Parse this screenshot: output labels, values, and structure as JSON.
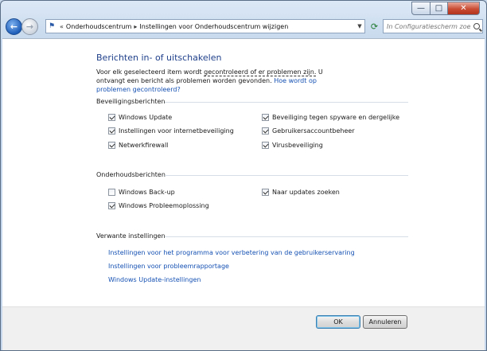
{
  "window": {
    "controls": {
      "minimize": "—",
      "maximize": "□",
      "close": "✕"
    }
  },
  "navigation": {
    "back_icon": "back-arrow-icon",
    "forward_icon": "forward-arrow-icon",
    "address_chevron": "«",
    "breadcrumb": [
      "Onderhoudscentrum",
      "Instellingen voor Onderhoudscentrum wijzigen"
    ],
    "search_placeholder": "In Configuratiescherm zoeken"
  },
  "page": {
    "title": "Berichten in- of uitschakelen",
    "intro_part1": "Voor elk geselecteerd item wordt ",
    "intro_dashed": "gecontroleerd of er problemen zijn.",
    "intro_part2": " U ontvangt een bericht als problemen worden gevonden. ",
    "intro_link": "Hoe wordt op problemen gecontroleerd?"
  },
  "security": {
    "heading": "Beveiligingsberichten",
    "items": [
      {
        "label": "Windows Update",
        "checked": true
      },
      {
        "label": "Instellingen voor internetbeveiliging",
        "checked": true
      },
      {
        "label": "Netwerkfirewall",
        "checked": true
      },
      {
        "label": "Beveiliging tegen spyware en dergelijke",
        "checked": true
      },
      {
        "label": "Gebruikersaccountbeheer",
        "checked": true
      },
      {
        "label": "Virusbeveiliging",
        "checked": true
      }
    ]
  },
  "maintenance": {
    "heading": "Onderhoudsberichten",
    "items": [
      {
        "label": "Windows Back-up",
        "checked": false
      },
      {
        "label": "Windows Probleemoplossing",
        "checked": true
      },
      {
        "label": "Naar updates zoeken",
        "checked": true
      }
    ]
  },
  "related": {
    "heading": "Verwante instellingen",
    "links": [
      "Instellingen voor het programma voor verbetering van de gebruikerservaring",
      "Instellingen voor probleemrapportage",
      "Windows Update-instellingen"
    ]
  },
  "footer": {
    "ok": "OK",
    "cancel": "Annuleren"
  }
}
